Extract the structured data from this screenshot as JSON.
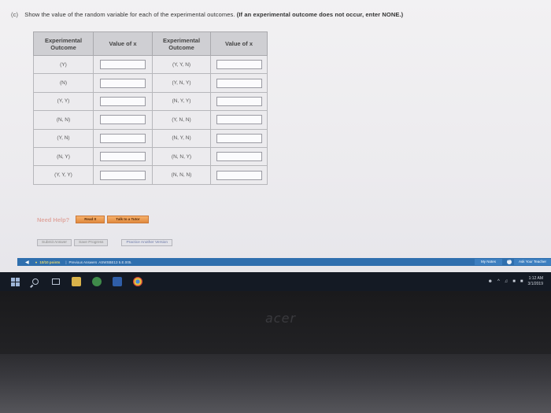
{
  "question": {
    "number": "(c)",
    "text": "Show the value of the random variable for each of the experimental outcomes.",
    "note": "(If an experimental outcome does not occur, enter NONE.)"
  },
  "table": {
    "headers": [
      "Experimental Outcome",
      "Value of x",
      "Experimental Outcome",
      "Value of x"
    ],
    "rows": [
      {
        "left": "(Y)",
        "right": "(Y, Y, N)"
      },
      {
        "left": "(N)",
        "right": "(Y, N, Y)"
      },
      {
        "left": "(Y, Y)",
        "right": "(N, Y, Y)"
      },
      {
        "left": "(N, N)",
        "right": "(Y, N, N)"
      },
      {
        "left": "(Y, N)",
        "right": "(N, Y, N)"
      },
      {
        "left": "(N, Y)",
        "right": "(N, N, Y)"
      },
      {
        "left": "(Y, Y, Y)",
        "right": "(N, N, N)"
      }
    ]
  },
  "help": {
    "label": "Need Help?",
    "read_it": "Read It",
    "talk_to_tutor": "Talk to a Tutor"
  },
  "actions": {
    "submit": "Submit Answer",
    "save": "Save Progress",
    "practice": "Practice Another Version"
  },
  "assignment_bar": {
    "score": "10/10 points",
    "previous_answers": "Previous Answers",
    "code": "ASWSBE13 5.E.005.",
    "my_notes": "My Notes",
    "ask": "Ask Your Teacher"
  },
  "taskbar": {
    "time": "1:12 AM",
    "date": "3/1/2019"
  },
  "brand": "acer",
  "colors": {
    "header_bg": "#cfcfd3",
    "help_button": "#f0a052",
    "assignment_bar": "#2f6fae",
    "help_label": "#e0a9a2"
  }
}
